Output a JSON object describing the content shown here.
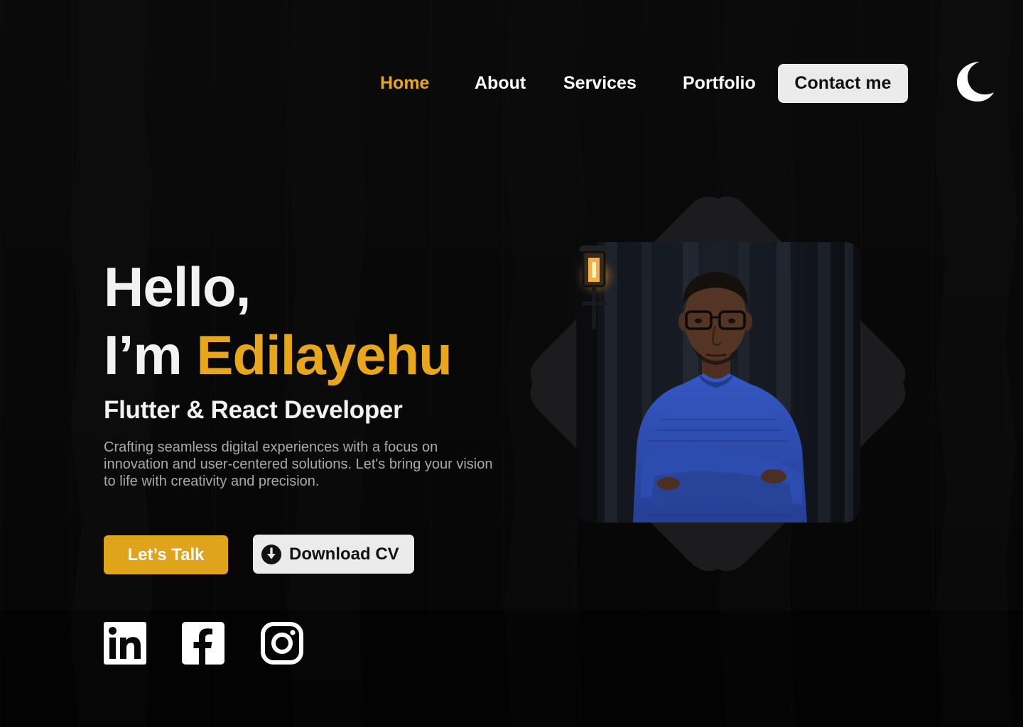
{
  "nav": {
    "items": [
      {
        "label": "Home",
        "active": true
      },
      {
        "label": "About",
        "active": false
      },
      {
        "label": "Services",
        "active": false
      },
      {
        "label": "Portfolio",
        "active": false
      }
    ],
    "contact_label": "Contact me",
    "theme_toggle_icon": "moon-icon"
  },
  "hero": {
    "greeting": "Hello,",
    "intro_prefix": "I’m ",
    "name": "Edilayehu",
    "role": "Flutter & React Developer",
    "description": "Crafting seamless digital experiences with a focus on innovation and user-centered solutions. Let's bring your vision to life with creativity and precision.",
    "primary_button": "Let’s Talk",
    "secondary_button": "Download CV",
    "secondary_button_icon": "download-icon"
  },
  "social": [
    {
      "name": "LinkedIn",
      "icon": "linkedin-icon"
    },
    {
      "name": "Facebook",
      "icon": "facebook-icon"
    },
    {
      "name": "Instagram",
      "icon": "instagram-icon"
    }
  ],
  "profile_photo": {
    "icon": "profile-photo",
    "subject": "man in blue sweater with glasses, arms crossed, lantern on left"
  },
  "colors": {
    "accent": "#e8a71a",
    "background": "#070707",
    "button_light": "#ebebeb",
    "text": "#f2f2f2",
    "muted_text": "#a9a9a9",
    "sweater": "#2f4fb5"
  }
}
